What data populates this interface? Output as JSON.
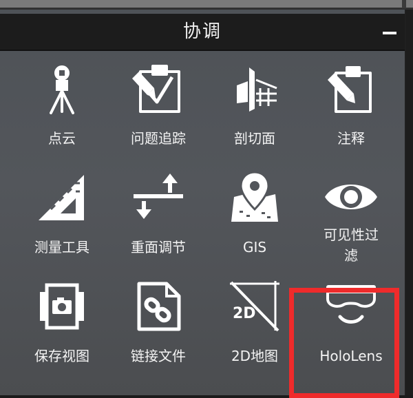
{
  "panel": {
    "title": "协调",
    "collapse_label": "−"
  },
  "tools": [
    {
      "label": "点云",
      "icon": "laser-scanner-icon"
    },
    {
      "label": "问题追踪",
      "icon": "clipboard-check-icon"
    },
    {
      "label": "剖切面",
      "icon": "section-plane-icon"
    },
    {
      "label": "注释",
      "icon": "annotation-clipboard-icon"
    },
    {
      "label": "测量工具",
      "icon": "triangle-ruler-icon"
    },
    {
      "label": "重面调节",
      "icon": "elevation-adjust-icon"
    },
    {
      "label": "GIS",
      "icon": "map-pin-icon"
    },
    {
      "label": "可见性过\n滤",
      "icon": "eye-icon"
    },
    {
      "label": "保存视图",
      "icon": "camera-view-icon"
    },
    {
      "label": "链接文件",
      "icon": "link-file-icon"
    },
    {
      "label": "2D地图",
      "icon": "2d-map-icon"
    },
    {
      "label": "HoloLens",
      "icon": "hololens-icon"
    }
  ],
  "colors": {
    "highlight": "#ef2b2b",
    "header_bg": "#1c1c1c",
    "icon": "#ffffff"
  }
}
